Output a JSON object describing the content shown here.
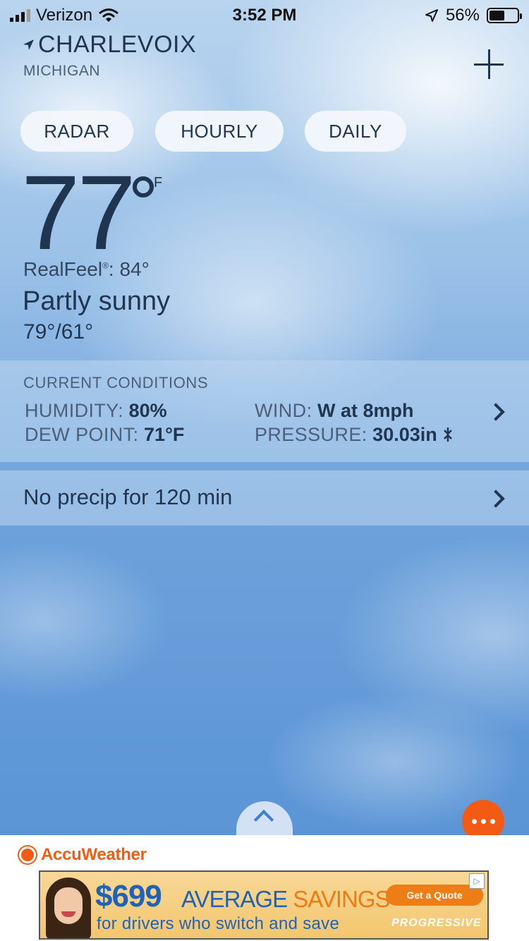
{
  "status_bar": {
    "carrier": "Verizon",
    "time": "3:52 PM",
    "battery": "56%",
    "battery_level": 0.56
  },
  "location": {
    "city": "CHARLEVOIX",
    "state": "MICHIGAN"
  },
  "tabs": [
    {
      "label": "RADAR"
    },
    {
      "label": "HOURLY"
    },
    {
      "label": "DAILY"
    }
  ],
  "current": {
    "temperature": "77",
    "unit": "F",
    "realfeel_label": "RealFeel",
    "realfeel_mark": "®",
    "realfeel_value": ": 84°",
    "phrase": "Partly sunny",
    "hi_lo": "79°/61°"
  },
  "conditions": {
    "title": "CURRENT CONDITIONS",
    "humidity_label": "HUMIDITY:",
    "humidity_value": "80%",
    "dew_label": "DEW POINT:",
    "dew_value": "71°F",
    "wind_label": "WIND:",
    "wind_value": "W at 8mph",
    "pressure_label": "PRESSURE:",
    "pressure_value": "30.03in"
  },
  "minutecast": {
    "text": "No precip for 120 min"
  },
  "footer": {
    "brand": "AccuWeather"
  },
  "ad": {
    "price": "$699",
    "headline_a": "AVERAGE",
    "headline_b": "SAVINGS",
    "subline": "for drivers who switch and save",
    "cta": "Get a Quote",
    "advertiser": "PROGRESSIVE"
  },
  "colors": {
    "accent": "#f35b14",
    "text": "#1f3550",
    "ad_blue": "#1e63b8"
  }
}
